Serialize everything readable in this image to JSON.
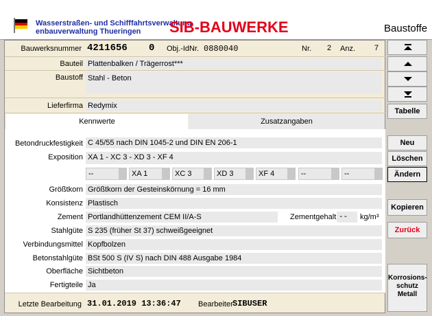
{
  "header": {
    "org_line1": "Wasserstraßen- und Schifffahrtsverwaltung",
    "org_line2": "enbauverwaltung Thueringen",
    "app_title": "SIB-BAUWERKE",
    "section_title": "Baustoffe"
  },
  "top": {
    "bauwerksnummer_label": "Bauwerksnummer",
    "bauwerksnummer_value": "4211656",
    "bauwerksnummer_suffix": "0",
    "objid_label": "Obj.-IdNr.",
    "objid_value": "0880040",
    "nr_label": "Nr.",
    "nr_value": "2",
    "anz_label": "Anz.",
    "anz_value": "7"
  },
  "fields_top": {
    "bauteil_label": "Bauteil",
    "bauteil_value": "Plattenbalken / Trägerrost***",
    "baustoff_label": "Baustoff",
    "baustoff_value": "Stahl - Beton",
    "lieferfirma_label": "Lieferfirma",
    "lieferfirma_value": "Redymix"
  },
  "tabs": {
    "kennwerte": "Kennwerte",
    "zusatzangaben": "Zusatzangaben"
  },
  "kennwerte": {
    "betondruck_label": "Betondruckfestigkeit",
    "betondruck_value": "C 45/55 nach DIN 1045-2 und DIN EN 206-1",
    "exposition_label": "Exposition",
    "exposition_value": "XA 1 - XC 3 - XD 3 - XF 4",
    "combos": [
      "--",
      "XA 1",
      "XC 3",
      "XD 3",
      "XF 4",
      "--",
      "--"
    ],
    "groesstkorn_label": "Größtkorn",
    "groesstkorn_value": "Größtkorn der Gesteinskörnung = 16 mm",
    "konsistenz_label": "Konsistenz",
    "konsistenz_value": "Plastisch",
    "zement_label": "Zement",
    "zement_value": "Portlandhüttenzement CEM II/A-S",
    "zementgehalt_label": "Zementgehalt",
    "zementgehalt_value": "--",
    "zementgehalt_unit": "kg/m³",
    "stahlguete_label": "Stahlgüte",
    "stahlguete_value": "S 235 (früher St 37) schweißgeeignet",
    "verbindungsmittel_label": "Verbindungsmittel",
    "verbindungsmittel_value": "Kopfbolzen",
    "betonstahl_label": "Betonstahlgüte",
    "betonstahl_value": "BSt 500 S (IV S) nach DIN 488 Ausgabe 1984",
    "oberflaeche_label": "Oberfläche",
    "oberflaeche_value": "Sichtbeton",
    "fertigteile_label": "Fertigteile",
    "fertigteile_value": "Ja"
  },
  "footer": {
    "letzte_label": "Letzte Bearbeitung",
    "letzte_value": "31.01.2019 13:36:47",
    "bearbeiter_label": "Bearbeiter",
    "bearbeiter_value": "SIBUSER"
  },
  "buttons": {
    "tabelle": "Tabelle",
    "neu": "Neu",
    "loeschen": "Löschen",
    "aendern": "Ändern",
    "kopieren": "Kopieren",
    "zurueck": "Zurück",
    "korrosion": "Korrosions-\nschutz\nMetall"
  },
  "colors": {
    "title_red": "#e2001a",
    "org_blue": "#1f2fa0",
    "panel_beige": "#f3ecd8",
    "sidebar_gray": "#d4d0c8"
  }
}
